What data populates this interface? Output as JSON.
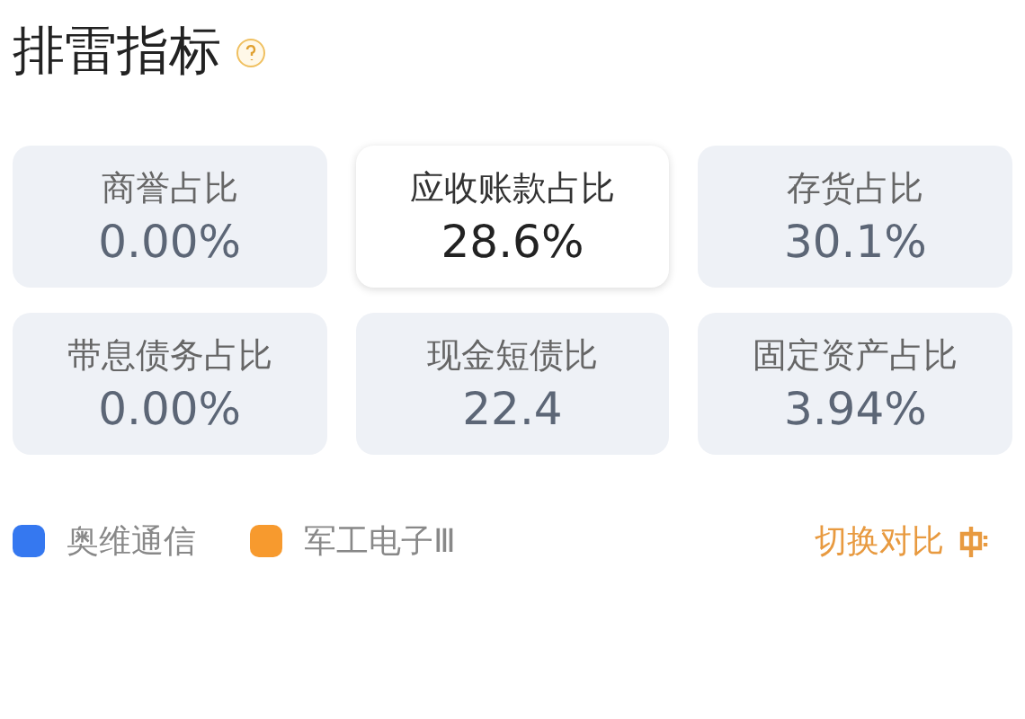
{
  "title": "排雷指标",
  "metrics": [
    {
      "label": "商誉占比",
      "value": "0.00%",
      "selected": false
    },
    {
      "label": "应收账款占比",
      "value": "28.6%",
      "selected": true
    },
    {
      "label": "存货占比",
      "value": "30.1%",
      "selected": false
    },
    {
      "label": "带息债务占比",
      "value": "0.00%",
      "selected": false
    },
    {
      "label": "现金短债比",
      "value": "22.4",
      "selected": false
    },
    {
      "label": "固定资产占比",
      "value": "3.94%",
      "selected": false
    }
  ],
  "legend": [
    {
      "label": "奥维通信",
      "color": "#3578f0"
    },
    {
      "label": "军工电子Ⅲ",
      "color": "#f79a2e"
    }
  ],
  "switch_button": "切换对比"
}
